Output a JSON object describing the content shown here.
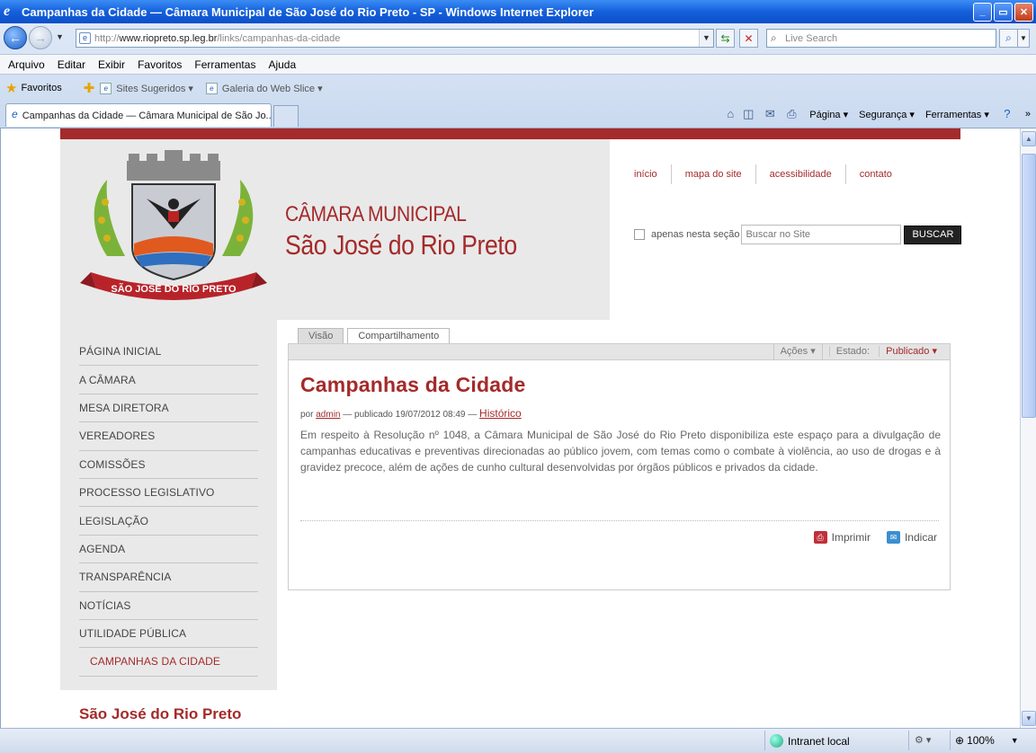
{
  "window": {
    "title": "Campanhas da Cidade — Câmara Municipal de São José do Rio Preto - SP - Windows Internet Explorer",
    "min_glyph": "_",
    "max_glyph": "▭",
    "close_glyph": "✕"
  },
  "address": {
    "prefix": "http://",
    "domain": "www.riopreto.sp.leg.br",
    "path": "/links/campanhas-da-cidade"
  },
  "search": {
    "placeholder": "Live Search"
  },
  "menu": [
    "Arquivo",
    "Editar",
    "Exibir",
    "Favoritos",
    "Ferramentas",
    "Ajuda"
  ],
  "favorites": {
    "main": "Favoritos",
    "items": [
      "Sites Sugeridos ▾",
      "Galeria do Web Slice ▾"
    ]
  },
  "tab": {
    "title": "Campanhas da Cidade — Câmara Municipal de São Jo..."
  },
  "commandbar": {
    "page": "Página ▾",
    "security": "Segurança ▾",
    "tools": "Ferramentas ▾",
    "chevron": "»"
  },
  "site": {
    "brand_line1": "CÂMARA MUNICIPAL",
    "brand_line2": "São José do Rio Preto",
    "crest_banner": "SÃO JOSÉ DO RIO PRETO",
    "top_links": [
      "início",
      "mapa do site",
      "acessibilidade",
      "contato"
    ],
    "search_option": "apenas nesta seção",
    "search_placeholder": "Buscar no Site",
    "search_button": "BUSCAR",
    "nav": [
      "PÁGINA INICIAL",
      "A CÂMARA",
      "MESA DIRETORA",
      "VEREADORES",
      "COMISSÕES",
      "PROCESSO LEGISLATIVO",
      "LEGISLAÇÃO",
      "AGENDA",
      "TRANSPARÊNCIA",
      "NOTÍCIAS",
      "UTILIDADE PÚBLICA"
    ],
    "nav_sub": "CAMPANHAS DA CIDADE",
    "footer_title": "São José do Rio Preto"
  },
  "content": {
    "tabs": [
      "Visão",
      "Compartilhamento"
    ],
    "actions_label": "Ações ▾",
    "state_label": "Estado:",
    "state_value": "Publicado ▾",
    "title": "Campanhas da Cidade",
    "by": "por",
    "author": "admin",
    "published": "— publicado 19/07/2012 08:49 —",
    "history": "Histórico",
    "body": "Em respeito à Resolução nº 1048, a Câmara Municipal de São José do Rio Preto disponibiliza este espaço para a divulgação de campanhas educativas e preventivas direcionadas ao público jovem, com temas como o combate à violência, ao uso de drogas e à gravidez precoce, além de ações de cunho cultural desenvolvidas por órgãos públicos e privados da cidade.",
    "print": "Imprimir",
    "send": "Indicar"
  },
  "status": {
    "zone": "Intranet local",
    "zoom": "100%"
  }
}
